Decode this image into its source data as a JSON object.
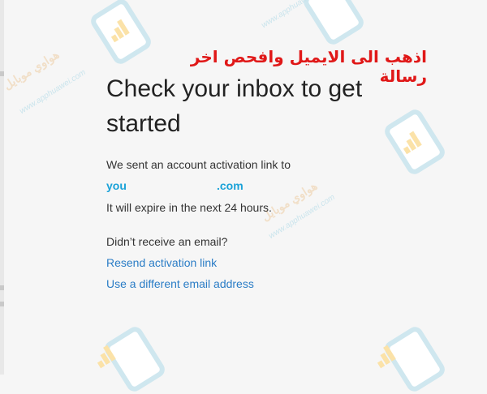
{
  "annotation": {
    "arabic_note": "اذهب الى الايميل وافحص اخر رسالة"
  },
  "watermark": {
    "brand": "هواوي موبايل",
    "url": "www.apphuawei.com"
  },
  "main": {
    "heading": "Check your inbox to get started",
    "sent_text": "We sent an account activation link to",
    "email_prefix": "you",
    "email_suffix": ".com",
    "expiry_text": "It will expire in the next 24 hours.",
    "no_email_text": "Didn’t receive an email?",
    "resend_link": "Resend activation link",
    "different_email_link": "Use a different email address"
  },
  "colors": {
    "annotation_red": "#e01818",
    "email_blue": "#1aa2d8",
    "link_blue": "#2b7dc6"
  }
}
